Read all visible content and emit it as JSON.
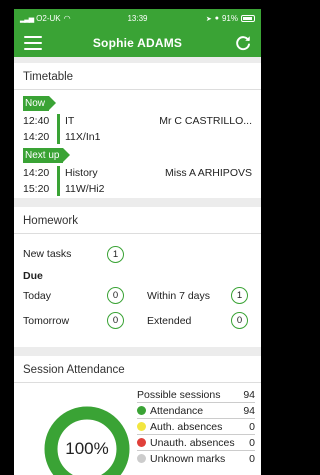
{
  "status_bar": {
    "carrier": "O2-UK",
    "time": "13:39",
    "battery": "91%"
  },
  "app_bar": {
    "title": "Sophie ADAMS",
    "menu_icon": "hamburger-icon",
    "refresh_icon": "refresh-icon"
  },
  "timetable": {
    "title": "Timetable",
    "now_label": "Now",
    "next_label": "Next up",
    "now": {
      "start": "12:40",
      "end": "14:20",
      "subject": "IT",
      "group": "11X/In1",
      "teacher": "Mr C CASTRILLO..."
    },
    "next": {
      "start": "14:20",
      "end": "15:20",
      "subject": "History",
      "group": "11W/Hi2",
      "teacher": "Miss A ARHIPOVS"
    }
  },
  "homework": {
    "title": "Homework",
    "new_tasks_label": "New tasks",
    "new_tasks_count": "1",
    "due_label": "Due",
    "today_label": "Today",
    "today_count": "0",
    "within7_label": "Within 7 days",
    "within7_count": "1",
    "tomorrow_label": "Tomorrow",
    "tomorrow_count": "0",
    "extended_label": "Extended",
    "extended_count": "0"
  },
  "attendance": {
    "title": "Session Attendance",
    "possible_label": "Possible sessions",
    "possible_value": "94",
    "percent": "100%",
    "percent_value": 100,
    "rows": [
      {
        "label": "Attendance",
        "value": "94",
        "color": "#3aa335"
      },
      {
        "label": "Auth. absences",
        "value": "0",
        "color": "#f2e640"
      },
      {
        "label": "Unauth. absences",
        "value": "0",
        "color": "#e0403a"
      },
      {
        "label": "Unknown marks",
        "value": "0",
        "color": "#cccccc"
      }
    ]
  },
  "colors": {
    "accent": "#3aa335"
  }
}
